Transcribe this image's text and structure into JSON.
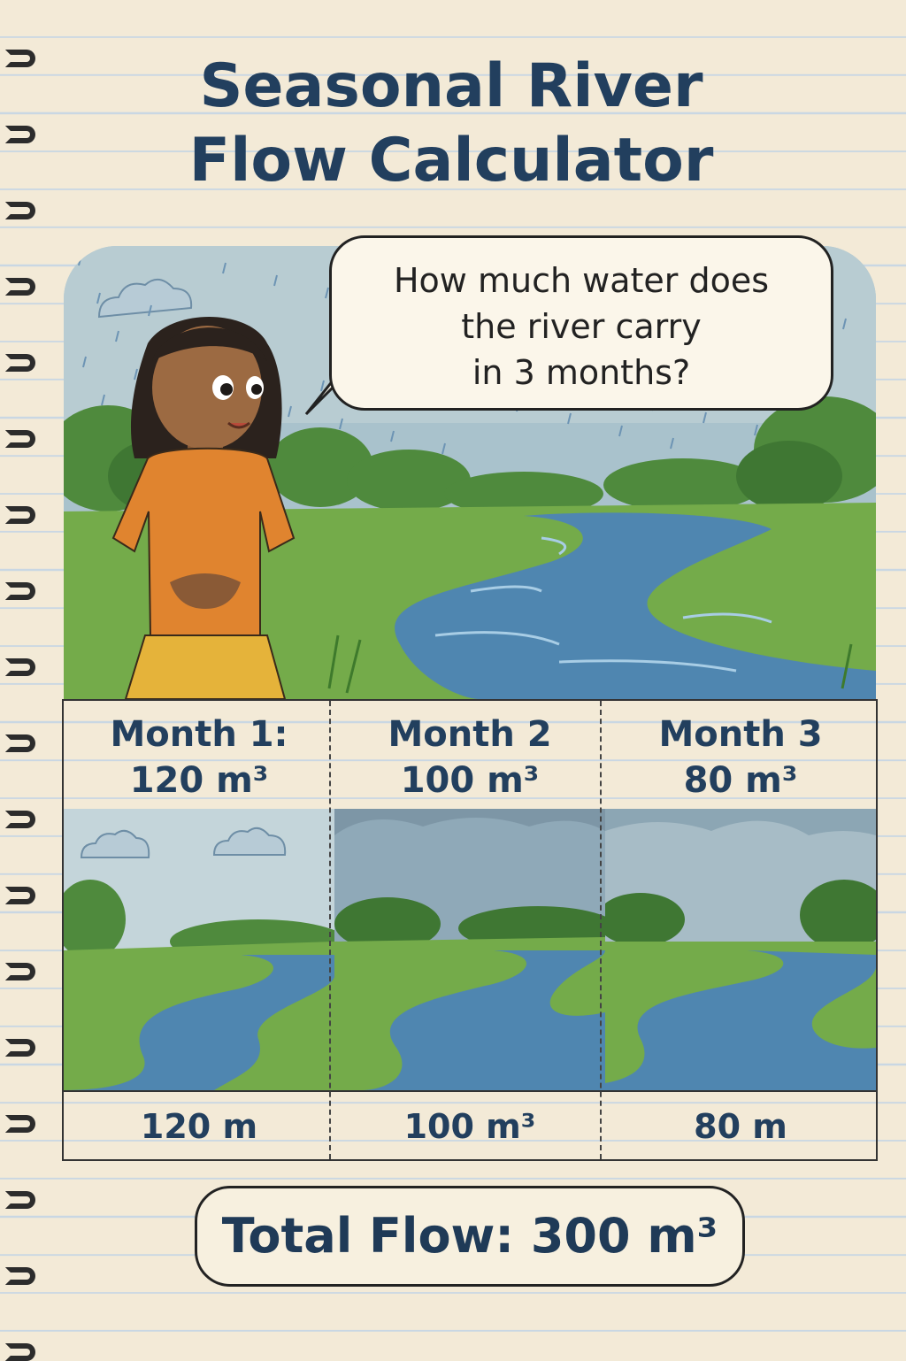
{
  "title": {
    "line1": "Seasonal River",
    "line2": "Flow Calculator"
  },
  "speech_bubble": {
    "line1": "How much water does",
    "line2": "the river carry",
    "line3": "in 3 months?"
  },
  "months": [
    {
      "label": "Month 1:",
      "header_value": "120 m³",
      "footer_value": "120 m"
    },
    {
      "label": "Month 2",
      "header_value": "100 m³",
      "footer_value": "100 m³"
    },
    {
      "label": "Month 3",
      "header_value": "80 m³",
      "footer_value": "80 m"
    }
  ],
  "total": "Total Flow: 300 m³",
  "icons": {
    "binding": "spiral-binding-icon",
    "character": "girl-character",
    "rain": "rain-icon",
    "cloud": "cloud-icon"
  },
  "colors": {
    "paper": "#f3ead7",
    "title": "#223f5e",
    "river": "#4f86b0",
    "grass": "#6fa443",
    "shirt": "#e0842f",
    "skirt": "#e5b33a"
  }
}
